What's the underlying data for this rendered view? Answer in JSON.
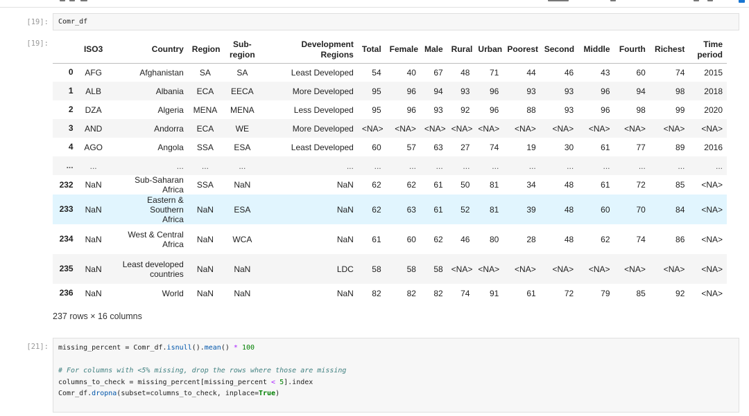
{
  "cells": [
    {
      "prompt": "[19]:",
      "code": "Comr_df",
      "out_prompt": "[19]:",
      "table": {
        "columns": [
          "ISO3",
          "Country",
          "Region",
          "Sub-\nregion",
          "Development\nRegions",
          "Total",
          "Female",
          "Male",
          "Rural",
          "Urban",
          "Poorest",
          "Second",
          "Middle",
          "Fourth",
          "Richest",
          "Time\nperiod"
        ],
        "rows": [
          {
            "index": "0",
            "cells": [
              "AFG",
              "Afghanistan",
              "SA",
              "SA",
              "Least Developed",
              "54",
              "40",
              "67",
              "48",
              "71",
              "44",
              "46",
              "43",
              "60",
              "74",
              "2015"
            ]
          },
          {
            "index": "1",
            "cells": [
              "ALB",
              "Albania",
              "ECA",
              "EECA",
              "More Developed",
              "95",
              "96",
              "94",
              "93",
              "96",
              "93",
              "93",
              "96",
              "94",
              "98",
              "2018"
            ]
          },
          {
            "index": "2",
            "cells": [
              "DZA",
              "Algeria",
              "MENA",
              "MENA",
              "Less Developed",
              "95",
              "96",
              "93",
              "92",
              "96",
              "88",
              "93",
              "96",
              "98",
              "99",
              "2020"
            ]
          },
          {
            "index": "3",
            "cells": [
              "AND",
              "Andorra",
              "ECA",
              "WE",
              "More Developed",
              "<NA>",
              "<NA>",
              "<NA>",
              "<NA>",
              "<NA>",
              "<NA>",
              "<NA>",
              "<NA>",
              "<NA>",
              "<NA>",
              "<NA>"
            ]
          },
          {
            "index": "4",
            "cells": [
              "AGO",
              "Angola",
              "SSA",
              "ESA",
              "Least Developed",
              "60",
              "57",
              "63",
              "27",
              "74",
              "19",
              "30",
              "61",
              "77",
              "89",
              "2016"
            ]
          },
          {
            "index": "...",
            "cells": [
              "...",
              "...",
              "...",
              "...",
              "...",
              "...",
              "...",
              "...",
              "...",
              "...",
              "...",
              "...",
              "...",
              "...",
              "...",
              "..."
            ]
          },
          {
            "index": "232",
            "cells": [
              "NaN",
              "Sub-Saharan Africa",
              "SSA",
              "NaN",
              "NaN",
              "62",
              "62",
              "61",
              "50",
              "81",
              "34",
              "48",
              "61",
              "72",
              "85",
              "<NA>"
            ]
          },
          {
            "index": "233",
            "cells": [
              "NaN",
              "Eastern & Southern\nAfrica",
              "NaN",
              "ESA",
              "NaN",
              "62",
              "63",
              "61",
              "52",
              "81",
              "39",
              "48",
              "60",
              "70",
              "84",
              "<NA>"
            ]
          },
          {
            "index": "234",
            "cells": [
              "NaN",
              "West & Central\nAfrica",
              "NaN",
              "WCA",
              "NaN",
              "61",
              "60",
              "62",
              "46",
              "80",
              "28",
              "48",
              "62",
              "74",
              "86",
              "<NA>"
            ]
          },
          {
            "index": "235",
            "cells": [
              "NaN",
              "Least developed\ncountries",
              "NaN",
              "NaN",
              "LDC",
              "58",
              "58",
              "58",
              "<NA>",
              "<NA>",
              "<NA>",
              "<NA>",
              "<NA>",
              "<NA>",
              "<NA>",
              "<NA>"
            ]
          },
          {
            "index": "236",
            "cells": [
              "NaN",
              "World",
              "NaN",
              "NaN",
              "NaN",
              "82",
              "82",
              "82",
              "74",
              "91",
              "61",
              "72",
              "79",
              "85",
              "92",
              "<NA>"
            ]
          }
        ]
      },
      "summary": "237 rows × 16 columns"
    },
    {
      "prompt": "[21]:",
      "code_lines": [
        "missing_percent = Comr_df.isnull().mean() * 100",
        "",
        "# For columns with <5% missing, drop the rows where those are missing",
        "columns_to_check = missing_percent[missing_percent < 5].index",
        "Comr_df.dropna(subset=columns_to_check, inplace=True)"
      ]
    }
  ],
  "colors": {
    "highlight_row": "#e1f5fe",
    "stripe_row": "#f5f5f5",
    "cell_bg": "#f7f7f7",
    "prompt": "#999999",
    "accent": "#1976d2"
  }
}
